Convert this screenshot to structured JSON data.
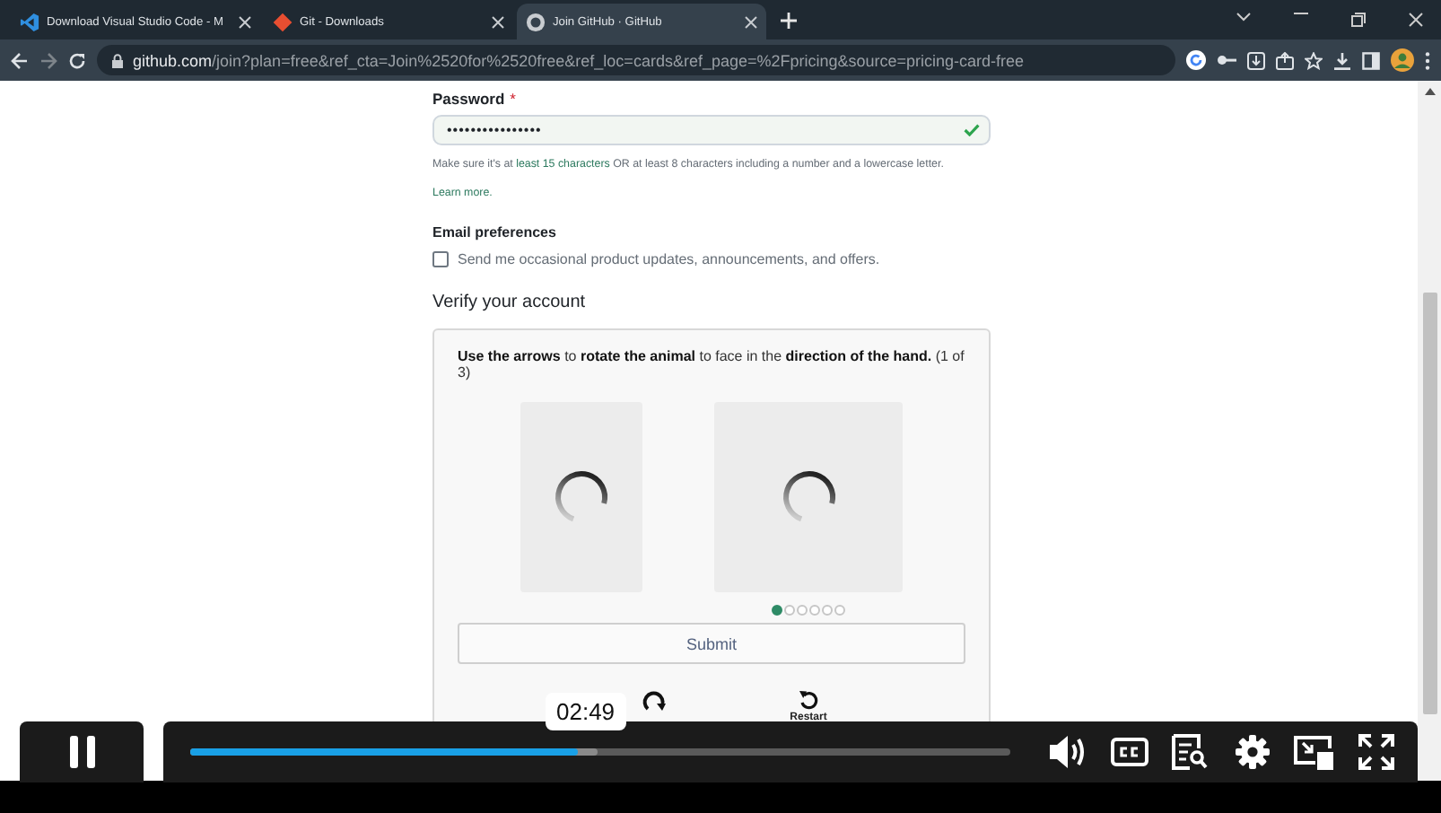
{
  "browser": {
    "tabs": [
      {
        "title": "Download Visual Studio Code - M",
        "selected": false
      },
      {
        "title": "Git - Downloads",
        "selected": false
      },
      {
        "title": "Join GitHub · GitHub",
        "selected": true
      }
    ],
    "url_host": "github.com",
    "url_path": "/join?plan=free&ref_cta=Join%2520for%2520free&ref_loc=cards&ref_page=%2Fpricing&source=pricing-card-free"
  },
  "form": {
    "password_label": "Password",
    "required_mark": "*",
    "password_value": "••••••••••••••••",
    "password_valid": true,
    "hint_before": "Make sure it's at ",
    "hint_link": "least 15 characters",
    "hint_after": " OR at least 8 characters including a number and a lowercase letter.",
    "learn_more": "Learn more.",
    "email_heading": "Email preferences",
    "email_option": {
      "label": "Send me occasional product updates, announcements, and offers.",
      "checked": false
    },
    "verify_heading": "Verify your account"
  },
  "captcha": {
    "instruction": "**Use the arrows** to **rotate the animal** to face in the **direction of the hand.** (1 of 3)",
    "dots": [
      {
        "selected": true
      },
      {
        "selected": false
      },
      {
        "selected": false
      },
      {
        "selected": false
      },
      {
        "selected": false
      },
      {
        "selected": false
      }
    ],
    "submit": "Submit",
    "restart": "Restart"
  },
  "player": {
    "playing": true,
    "time_tooltip": "02:49",
    "progress": {
      "level": 0.473
    },
    "buffered": {
      "level": 0.497
    }
  }
}
